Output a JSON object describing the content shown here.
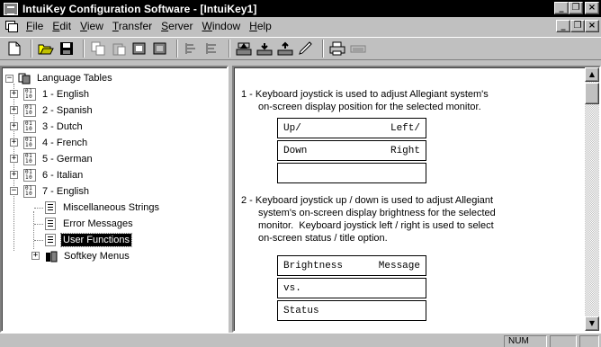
{
  "window": {
    "title": "IntuiKey Configuration Software - [IntuiKey1]"
  },
  "menu": {
    "items": [
      {
        "label": "File",
        "underline": "F",
        "rest": "ile"
      },
      {
        "label": "Edit",
        "underline": "E",
        "rest": "dit"
      },
      {
        "label": "View",
        "underline": "V",
        "rest": "iew"
      },
      {
        "label": "Transfer",
        "underline": "T",
        "rest": "ransfer"
      },
      {
        "label": "Server",
        "underline": "S",
        "rest": "erver"
      },
      {
        "label": "Window",
        "underline": "W",
        "rest": "indow"
      },
      {
        "label": "Help",
        "underline": "H",
        "rest": "elp"
      }
    ]
  },
  "toolbar": {
    "buttons": [
      "new-icon",
      "open-icon",
      "save-icon",
      "copy-icon",
      "paste-icon",
      "fill-icon",
      "fill-all-icon",
      "flow-icon",
      "flow-all-icon",
      "upload-icon",
      "download-icon",
      "transfer-icon",
      "edit-icon",
      "print-icon",
      "keyboard-icon"
    ]
  },
  "tree": {
    "root": "Language Tables",
    "languages": [
      "1 - English",
      "2 - Spanish",
      "3 - Dutch",
      "4 - French",
      "5 - German",
      "6 - Italian",
      "7 - English"
    ],
    "children": [
      "Miscellaneous Strings",
      "Error Messages",
      "User Functions"
    ],
    "softkey": "Softkey Menus",
    "selected": "User Functions"
  },
  "content": {
    "item1": {
      "line1": "1 - Keyboard joystick is used to adjust Allegiant system's",
      "line2": "on-screen display position for the selected monitor.",
      "rows": [
        {
          "left": "Up/",
          "right": "Left/"
        },
        {
          "left": "Down",
          "right": "Right"
        },
        {
          "left": "",
          "right": ""
        }
      ]
    },
    "item2": {
      "line1": "2 - Keyboard joystick up / down is used to adjust Allegiant",
      "line2": "system's on-screen display brightness for the selected",
      "line3": "monitor.  Keyboard joystick left / right is used to select",
      "line4": "on-screen status / title option.",
      "rows": [
        {
          "left": "Brightness",
          "right": "Message"
        },
        {
          "left": "vs.",
          "right": ""
        },
        {
          "left": "Status",
          "right": ""
        }
      ]
    }
  },
  "status": {
    "num": "NUM"
  }
}
